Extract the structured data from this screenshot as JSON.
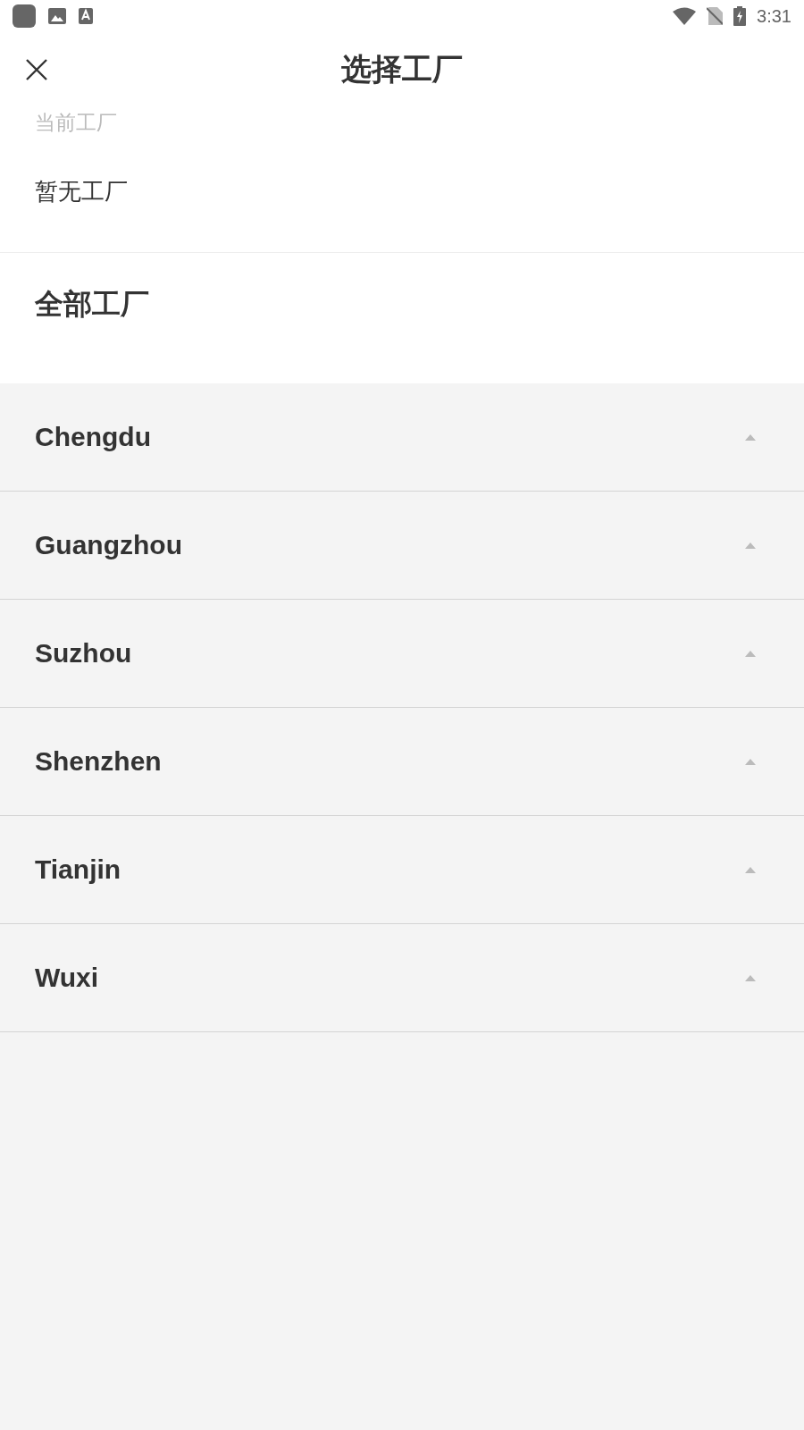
{
  "status_bar": {
    "time": "3:31"
  },
  "header": {
    "title": "选择工厂"
  },
  "current": {
    "label": "当前工厂",
    "value": "暂无工厂"
  },
  "all": {
    "title": "全部工厂"
  },
  "cities": [
    {
      "name": "Chengdu"
    },
    {
      "name": "Guangzhou"
    },
    {
      "name": "Suzhou"
    },
    {
      "name": "Shenzhen"
    },
    {
      "name": "Tianjin"
    },
    {
      "name": "Wuxi"
    }
  ]
}
